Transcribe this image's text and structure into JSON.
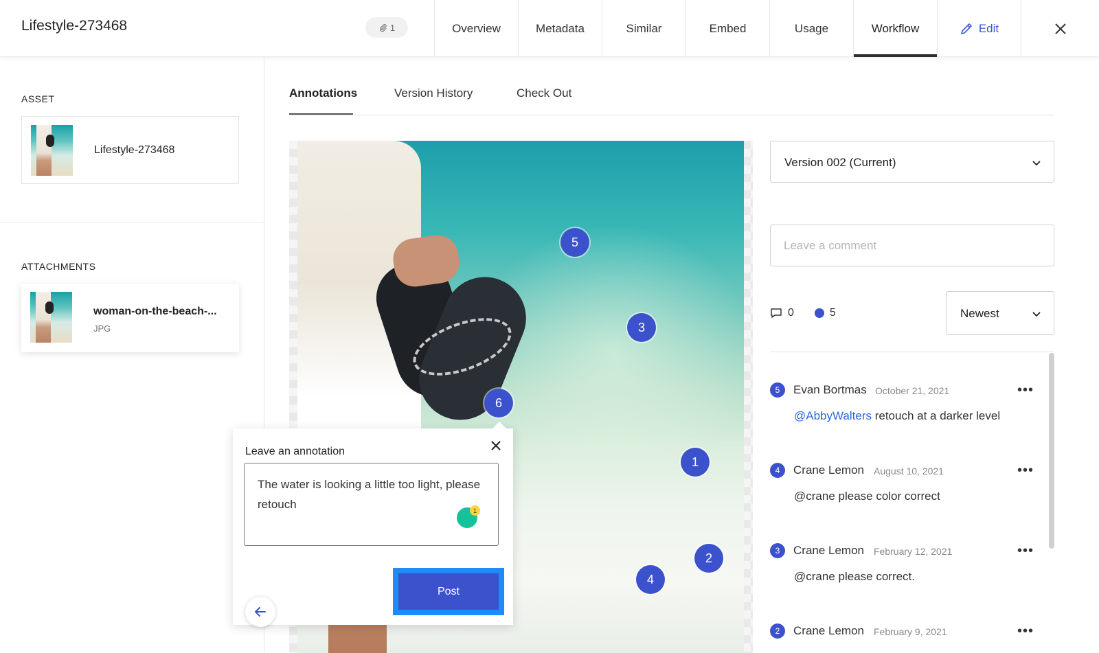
{
  "header": {
    "title": "Lifestyle-273468",
    "attachment_count": "1",
    "tabs": [
      {
        "label": "Overview"
      },
      {
        "label": "Metadata"
      },
      {
        "label": "Similar"
      },
      {
        "label": "Embed"
      },
      {
        "label": "Usage"
      },
      {
        "label": "Workflow",
        "active": true
      }
    ],
    "edit_label": "Edit"
  },
  "left_panel": {
    "asset_label": "ASSET",
    "asset_name": "Lifestyle-273468",
    "attachments_label": "ATTACHMENTS",
    "attachment": {
      "name": "woman-on-the-beach-...",
      "type": "JPG"
    }
  },
  "subtabs": [
    "Annotations",
    "Version History",
    "Check Out"
  ],
  "annotation_markers": [
    "5",
    "3",
    "6",
    "1",
    "2",
    "4"
  ],
  "popup": {
    "heading": "Leave an annotation",
    "text": "The water is looking a little too light, please retouch",
    "grammarly_count": "1",
    "post_label": "Post"
  },
  "version_select": "Version  002  (Current)",
  "comment_placeholder": "Leave a comment",
  "counts": {
    "comments": "0",
    "annotations": "5"
  },
  "sort_select": "Newest",
  "comments": [
    {
      "num": "5",
      "author": "Evan Bortmas",
      "date": "October 21, 2021",
      "mention": "@AbbyWalters",
      "text": " retouch at a darker level"
    },
    {
      "num": "4",
      "author": "Crane Lemon",
      "date": "August 10, 2021",
      "mention": "",
      "text": "@crane please color correct"
    },
    {
      "num": "3",
      "author": "Crane Lemon",
      "date": "February 12, 2021",
      "mention": "",
      "text": "@crane please correct."
    },
    {
      "num": "2",
      "author": "Crane Lemon",
      "date": "February 9, 2021",
      "mention": "",
      "text": ""
    }
  ],
  "colors": {
    "accent": "#3c52cc",
    "focus": "#1d8cf8",
    "link": "#2a66d8"
  }
}
